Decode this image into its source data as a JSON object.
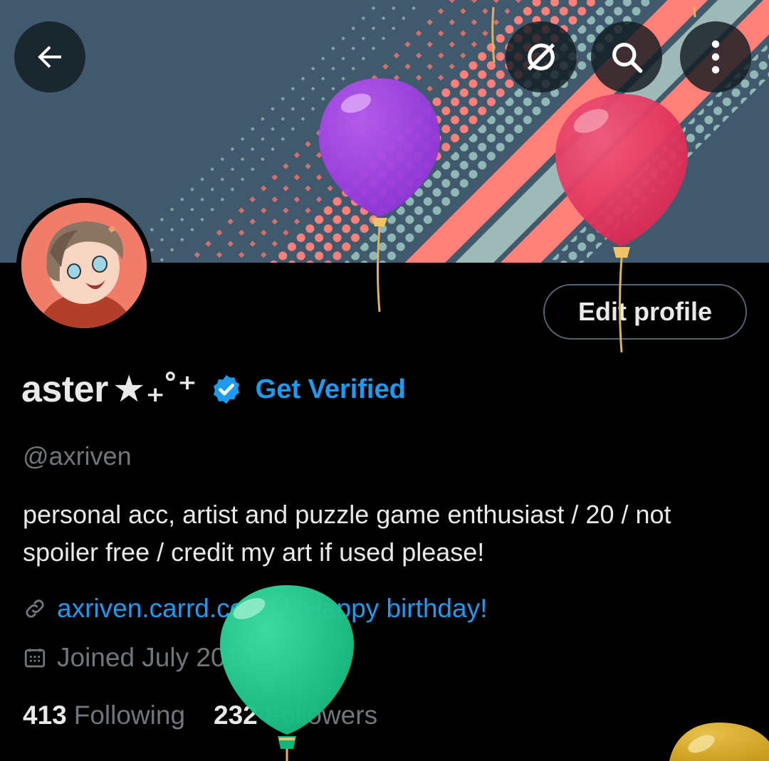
{
  "header": {
    "back_icon": "arrow-left-icon",
    "grok_icon": "grok-icon",
    "search_icon": "search-icon",
    "more_icon": "more-vertical-icon"
  },
  "profile": {
    "edit_button": "Edit profile",
    "display_name": "aster",
    "name_decoration": "★₊˚⁺",
    "get_verified": "Get Verified",
    "handle": "@axriven",
    "bio": "personal acc, artist and puzzle game enthusiast / 20 / not spoiler free / credit my art if used please!",
    "website": "axriven.carrd.co",
    "birthday": "Happy birthday!",
    "joined": "Joined July 2018",
    "following_count": "413",
    "following_label": "Following",
    "followers_count": "232",
    "followers_label": "Followers"
  },
  "colors": {
    "accent": "#1d9bf0",
    "muted": "#71767b",
    "text": "#e7e9ea",
    "background": "#000000"
  }
}
